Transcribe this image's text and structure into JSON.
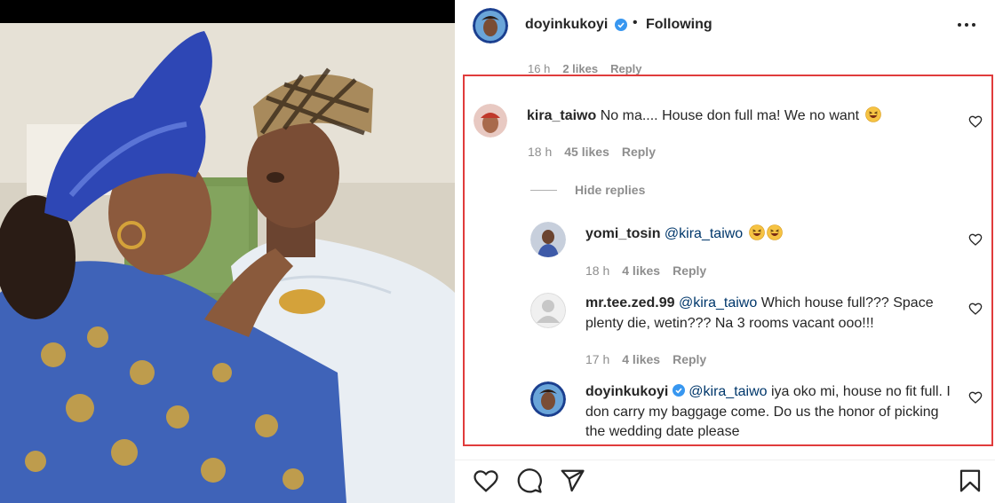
{
  "post": {
    "author": "doyinkukoyi",
    "separator": "•",
    "follow_state": "Following",
    "colors": {
      "verified": "#3897f0",
      "highlight": "#e03c3c",
      "mention": "#00376b",
      "meta": "#8e8e8e"
    }
  },
  "faded_row": {
    "time": "16 h",
    "likes": "2 likes",
    "reply": "Reply"
  },
  "comments": [
    {
      "username": "kira_taiwo",
      "text": "No ma.... House don full ma! We no want",
      "emoji": [
        "grinning-squinting-face"
      ],
      "time": "18 h",
      "likes": "45 likes",
      "reply": "Reply"
    }
  ],
  "hide_replies_label": "Hide replies",
  "replies": [
    {
      "username": "yomi_tosin",
      "mention": "@kira_taiwo",
      "text": "",
      "emoji": [
        "grinning-squinting-face",
        "grinning-squinting-face"
      ],
      "time": "18 h",
      "likes": "4 likes",
      "reply": "Reply"
    },
    {
      "username": "mr.tee.zed.99",
      "mention": "@kira_taiwo",
      "text": "Which house full??? Space plenty die, wetin??? Na 3 rooms vacant ooo!!!",
      "time": "17 h",
      "likes": "4 likes",
      "reply": "Reply"
    },
    {
      "username": "doyinkukoyi",
      "verified": true,
      "mention": "@kira_taiwo",
      "text": "iya oko mi, house no fit full. I don carry my baggage come. Do us the honor of picking the wedding date please"
    }
  ],
  "icons": {
    "more": "more-options-icon",
    "like": "heart-icon",
    "comment": "comment-icon",
    "share": "share-icon",
    "save": "bookmark-icon"
  }
}
